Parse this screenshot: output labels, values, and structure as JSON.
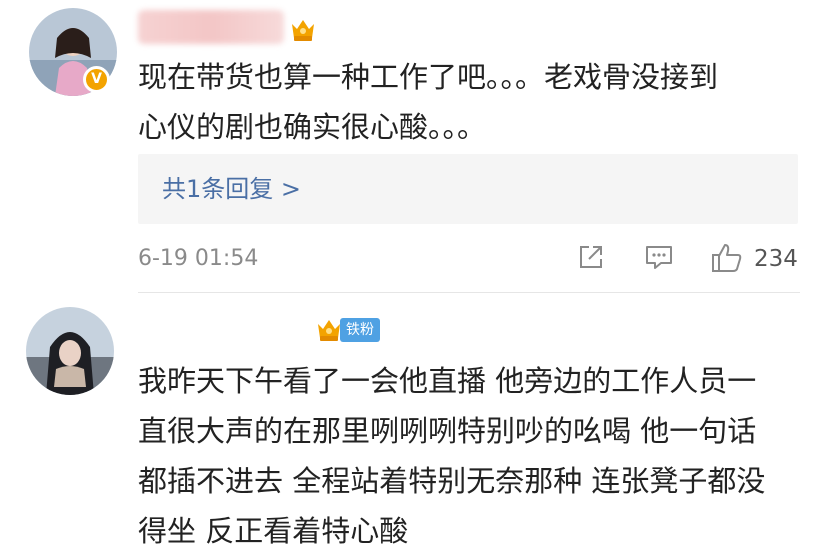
{
  "comments": [
    {
      "text_lines": [
        "现在带货也算一种工作了吧。。。老戏骨没接到",
        "心仪的剧也确实很心酸。。。"
      ],
      "reply_link": "共1条回复 >",
      "timestamp": "6-19 01:54",
      "likes": "234",
      "verified_badge": "V",
      "icons": {
        "share": "share-icon",
        "comment": "comment-icon",
        "like": "thumbs-up-icon",
        "vip": "crown-vip-icon"
      }
    },
    {
      "fan_badge": "铁粉",
      "text_lines": [
        "我昨天下午看了一会他直播 他旁边的工作人员一",
        "直很大声的在那里咧咧咧特别吵的吆喝 他一句话",
        "都插不进去 全程站着特别无奈那种 连张凳子都没",
        "得坐 反正看着特心酸"
      ],
      "icons": {
        "vip": "crown-vip-icon"
      }
    }
  ],
  "colors": {
    "link": "#4a6fa5",
    "badge_gold": "#f3a300",
    "fan_badge": "#4fa1e3",
    "meta": "#8a8a8a"
  }
}
